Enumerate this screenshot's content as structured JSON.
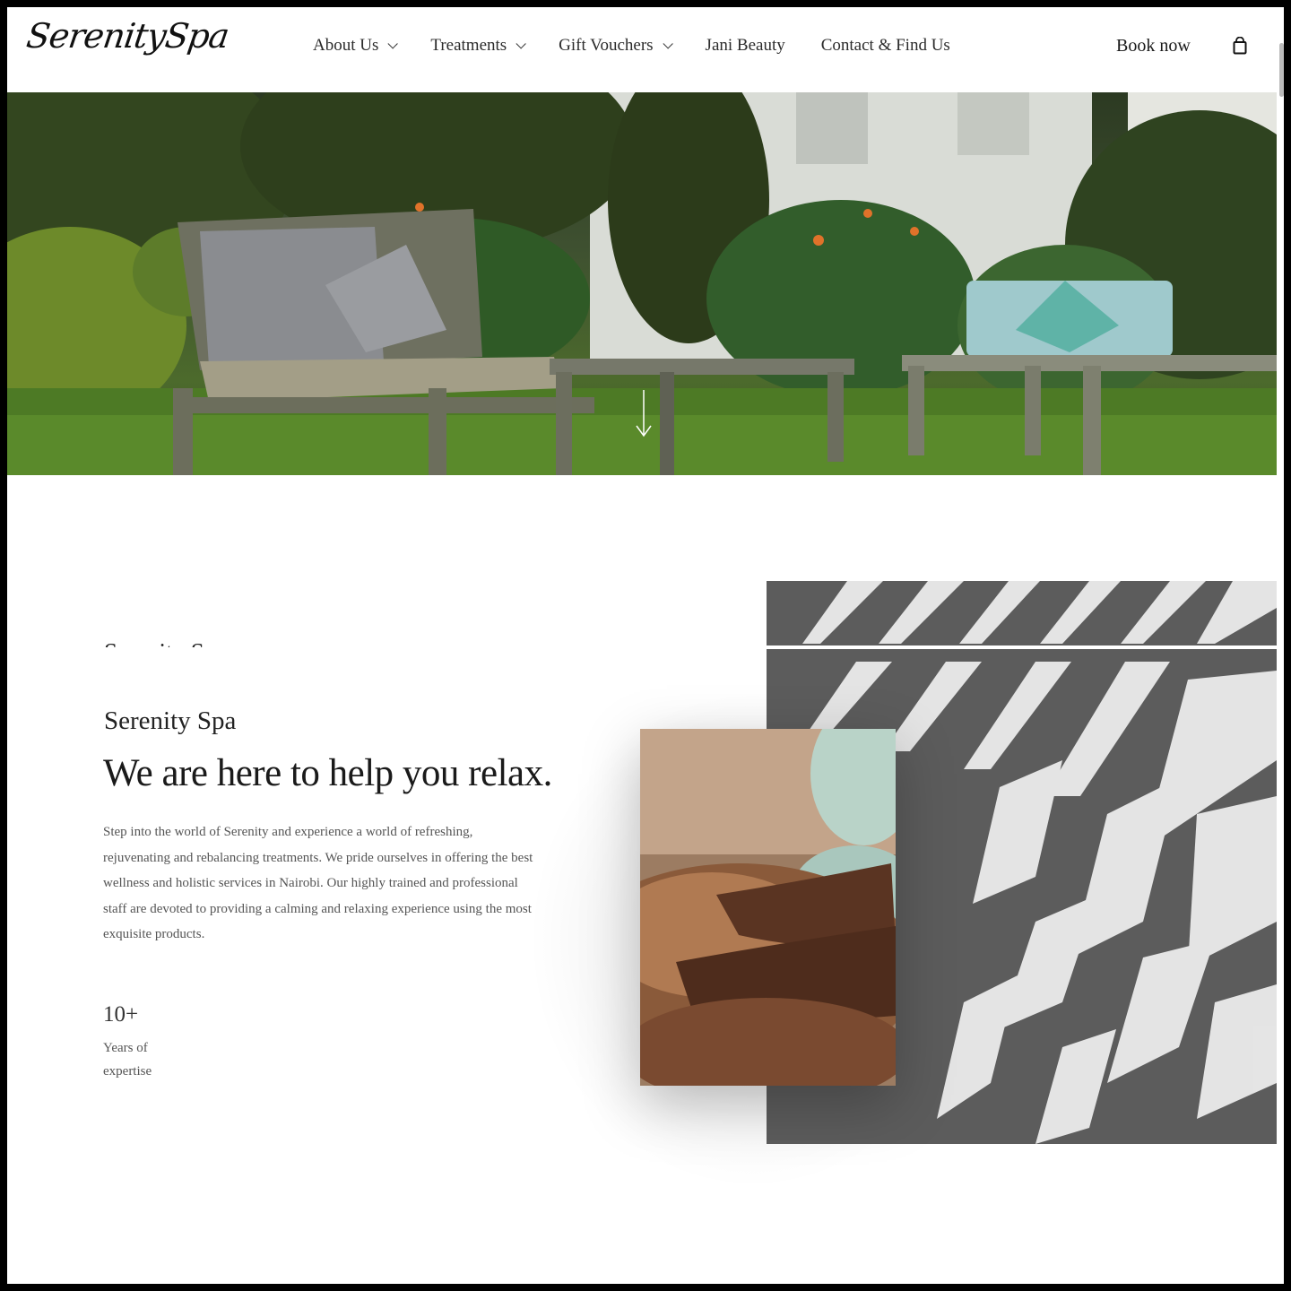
{
  "brand": {
    "logo_text": "SerenitySpa"
  },
  "nav": {
    "items": [
      {
        "label": "About Us",
        "has_dropdown": true
      },
      {
        "label": "Treatments",
        "has_dropdown": true
      },
      {
        "label": "Gift Vouchers",
        "has_dropdown": true
      },
      {
        "label": "Jani Beauty",
        "has_dropdown": false
      },
      {
        "label": "Contact & Find Us",
        "has_dropdown": false
      }
    ],
    "book_label": "Book now",
    "cart_icon": "shopping-bag-icon"
  },
  "hero": {
    "scroll_icon": "arrow-down-icon"
  },
  "about": {
    "kicker": "Serenity Spa",
    "subtitle": "Serenity Spa",
    "headline": "We are here to help you relax.",
    "body": "Step into the world of Serenity and experience a world of refreshing, rejuvenating and rebalancing treatments. We pride ourselves in offering the best wellness and holistic services in Nairobi. Our highly trained and professional staff are devoted to providing a calming and relaxing experience using the most exquisite products.",
    "stat_number": "10+",
    "stat_label": "Years of expertise"
  },
  "colors": {
    "text_dark": "#1a1a1a",
    "text_body": "#555555",
    "background": "#ffffff"
  }
}
